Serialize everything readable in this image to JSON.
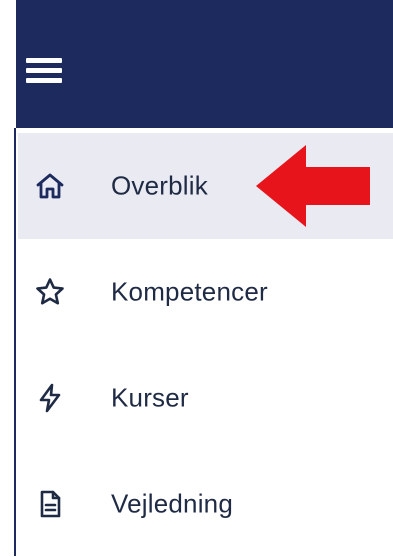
{
  "header": {
    "menu_icon": "hamburger-menu-icon",
    "background_color": "#1d2a5e"
  },
  "nav": {
    "items": [
      {
        "label": "Overblik",
        "icon": "home-icon",
        "active": true
      },
      {
        "label": "Kompetencer",
        "icon": "star-icon",
        "active": false
      },
      {
        "label": "Kurser",
        "icon": "lightning-bolt-icon",
        "active": false
      },
      {
        "label": "Vejledning",
        "icon": "document-icon",
        "active": false
      }
    ]
  },
  "annotation": {
    "arrow_icon": "red-pointer-arrow",
    "arrow_color": "#e8141b"
  }
}
